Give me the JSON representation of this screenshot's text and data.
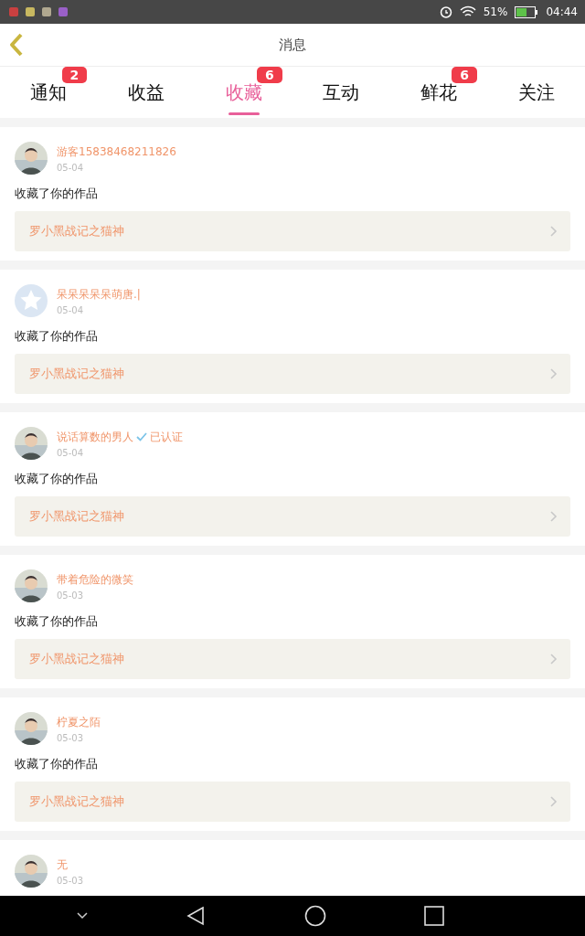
{
  "status_bar": {
    "battery": "51%",
    "time": "04:44"
  },
  "header": {
    "title": "消息"
  },
  "tabs": [
    {
      "label": "通知",
      "badge": "2",
      "selected": false
    },
    {
      "label": "收益",
      "selected": false
    },
    {
      "label": "收藏",
      "badge": "6",
      "selected": true
    },
    {
      "label": "互动",
      "selected": false
    },
    {
      "label": "鲜花",
      "badge": "6",
      "selected": false
    },
    {
      "label": "关注",
      "selected": false
    }
  ],
  "items": [
    {
      "name": "游客15838468211826",
      "date": "05-04",
      "action": "收藏了你的作品",
      "work": "罗小黑战记之猫神"
    },
    {
      "avatar": {
        "kind": "default"
      },
      "name": "呆呆呆呆呆萌唐.|",
      "date": "05-04",
      "action": "收藏了你的作品",
      "work": "罗小黑战记之猫神"
    },
    {
      "name": "说话算数的男人",
      "verified": true,
      "verified_label": "已认证",
      "date": "05-04",
      "action": "收藏了你的作品",
      "work": "罗小黑战记之猫神"
    },
    {
      "name": "带着危险的微笑",
      "date": "05-03",
      "action": "收藏了你的作品",
      "work": "罗小黑战记之猫神"
    },
    {
      "name": "柠夏之陌",
      "date": "05-03",
      "action": "收藏了你的作品",
      "work": "罗小黑战记之猫神"
    },
    {
      "name": "无",
      "date": "05-03"
    }
  ]
}
